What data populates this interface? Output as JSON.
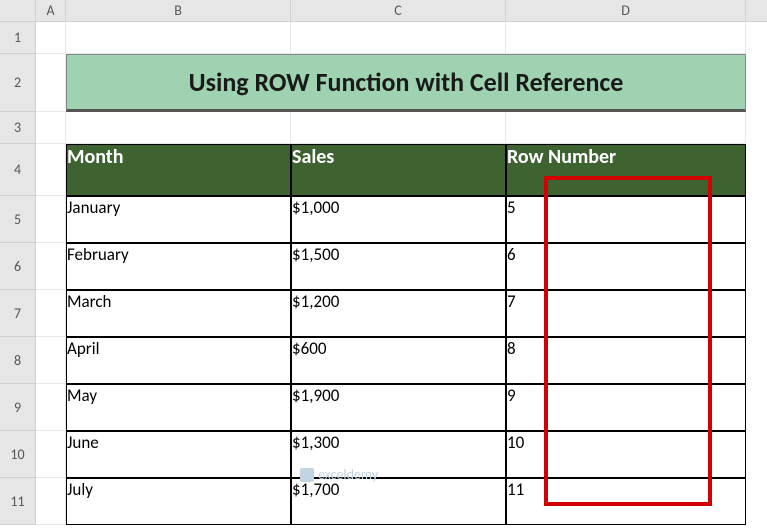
{
  "columns": {
    "A": "A",
    "B": "B",
    "C": "C",
    "D": "D"
  },
  "rows": {
    "r1": "1",
    "r2": "2",
    "r3": "3",
    "r4": "4",
    "r5": "5",
    "r6": "6",
    "r7": "7",
    "r8": "8",
    "r9": "9",
    "r10": "10",
    "r11": "11"
  },
  "title": "Using ROW Function with Cell Reference",
  "headers": {
    "month": "Month",
    "sales": "Sales",
    "rownum": "Row Number"
  },
  "data": [
    {
      "month": "January",
      "sales": "$1,000",
      "rownum": "5"
    },
    {
      "month": "February",
      "sales": "$1,500",
      "rownum": "6"
    },
    {
      "month": "March",
      "sales": "$1,200",
      "rownum": "7"
    },
    {
      "month": "April",
      "sales": "$600",
      "rownum": "8"
    },
    {
      "month": "May",
      "sales": "$1,900",
      "rownum": "9"
    },
    {
      "month": "June",
      "sales": "$1,300",
      "rownum": "10"
    },
    {
      "month": "July",
      "sales": "$1,700",
      "rownum": "11"
    }
  ],
  "watermark": "exceldemy",
  "chart_data": {
    "type": "table",
    "title": "Using ROW Function with Cell Reference",
    "columns": [
      "Month",
      "Sales",
      "Row Number"
    ],
    "rows": [
      [
        "January",
        1000,
        5
      ],
      [
        "February",
        1500,
        6
      ],
      [
        "March",
        1200,
        7
      ],
      [
        "April",
        600,
        8
      ],
      [
        "May",
        1900,
        9
      ],
      [
        "June",
        1300,
        10
      ],
      [
        "July",
        1700,
        11
      ]
    ]
  }
}
